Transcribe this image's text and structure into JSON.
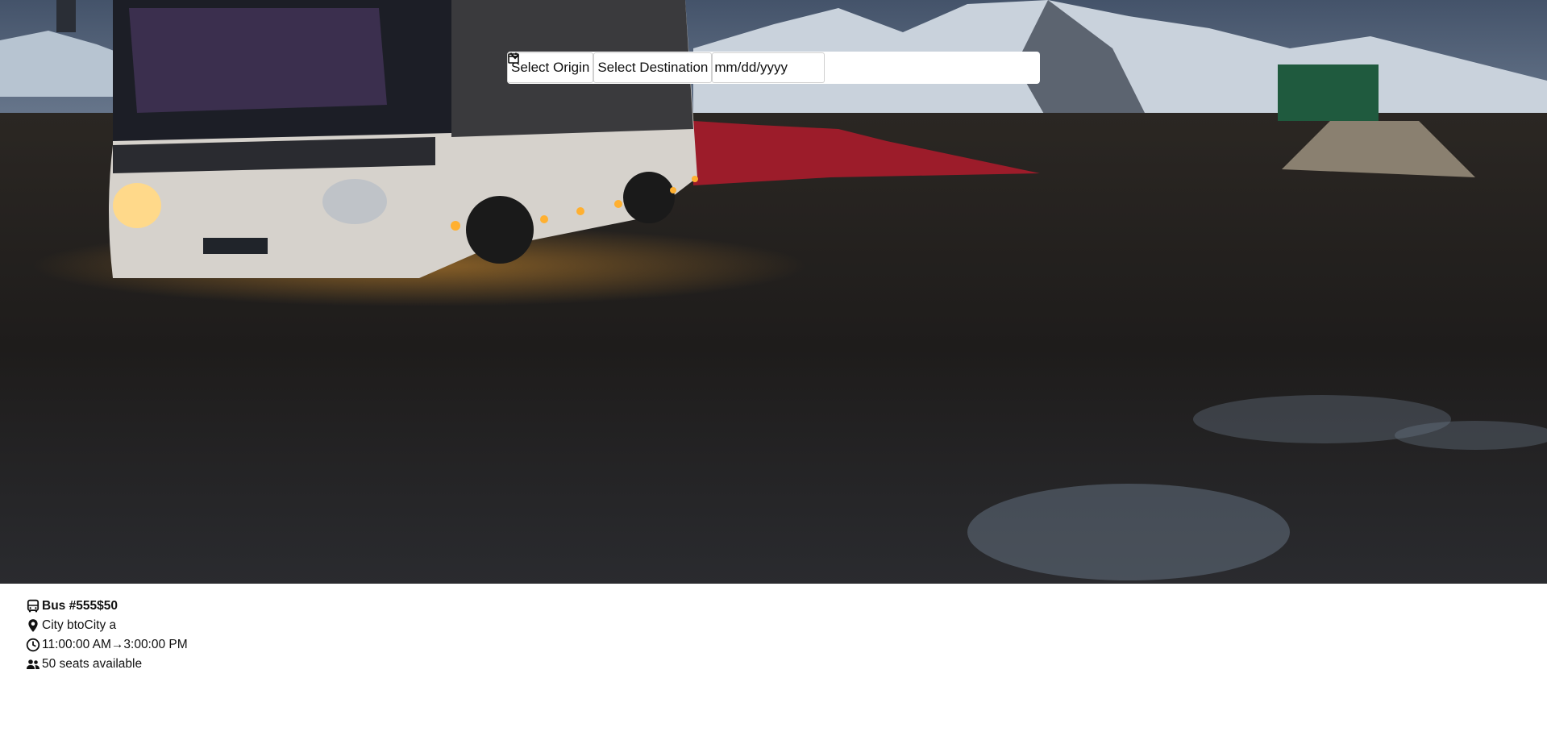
{
  "search": {
    "origin_placeholder": "Select Origin",
    "destination_placeholder": "Select Destination",
    "date_placeholder": "mm/dd/yyyy"
  },
  "result": {
    "bus_name": "Bus #555",
    "price": "$50",
    "route": "City btoCity a",
    "departure": "11:00:00 AM",
    "arrow": "→",
    "arrival": "3:00:00 PM",
    "seats": "50 seats available"
  },
  "icons": {
    "bus": "bus-icon",
    "location": "map-pin-icon",
    "clock": "clock-icon",
    "people": "people-icon",
    "calendar": "calendar-icon",
    "chevron": "chevron-down-icon"
  }
}
